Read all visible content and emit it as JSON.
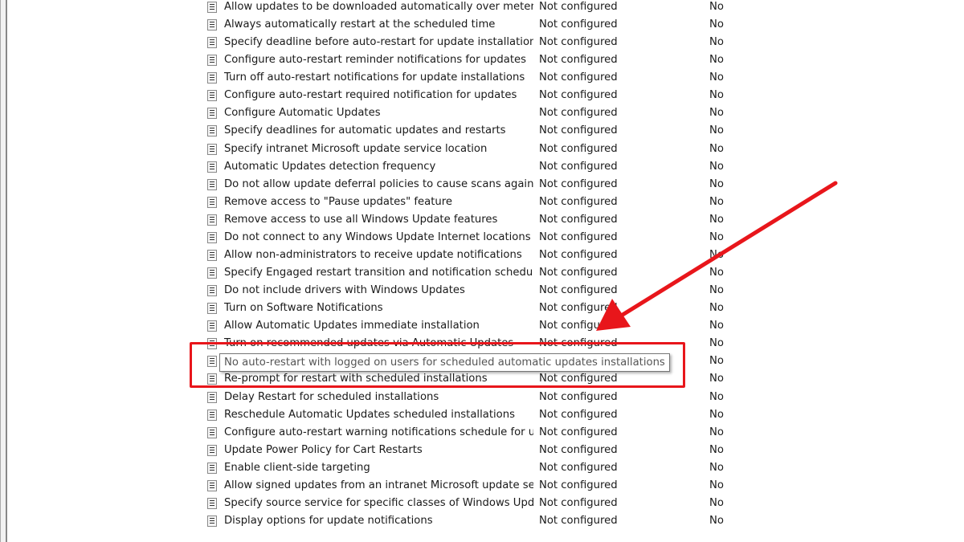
{
  "rows": [
    [
      "Allow updates to be downloaded automatically over metere...",
      "Not configured",
      "No"
    ],
    [
      "Always automatically restart at the scheduled time",
      "Not configured",
      "No"
    ],
    [
      "Specify deadline before auto-restart for update installation",
      "Not configured",
      "No"
    ],
    [
      "Configure auto-restart reminder notifications for updates",
      "Not configured",
      "No"
    ],
    [
      "Turn off auto-restart notifications for update installations",
      "Not configured",
      "No"
    ],
    [
      "Configure auto-restart required notification for updates",
      "Not configured",
      "No"
    ],
    [
      "Configure Automatic Updates",
      "Not configured",
      "No"
    ],
    [
      "Specify deadlines for automatic updates and restarts",
      "Not configured",
      "No"
    ],
    [
      "Specify intranet Microsoft update service location",
      "Not configured",
      "No"
    ],
    [
      "Automatic Updates detection frequency",
      "Not configured",
      "No"
    ],
    [
      "Do not allow update deferral policies to cause scans against ...",
      "Not configured",
      "No"
    ],
    [
      "Remove access to \"Pause updates\" feature",
      "Not configured",
      "No"
    ],
    [
      "Remove access to use all Windows Update features",
      "Not configured",
      "No"
    ],
    [
      "Do not connect to any Windows Update Internet locations",
      "Not configured",
      "No"
    ],
    [
      "Allow non-administrators to receive update notifications",
      "Not configured",
      "No"
    ],
    [
      "Specify Engaged restart transition and notification schedule ...",
      "Not configured",
      "No"
    ],
    [
      "Do not include drivers with Windows Updates",
      "Not configured",
      "No"
    ],
    [
      "Turn on Software Notifications",
      "Not configured",
      "No"
    ],
    [
      "Allow Automatic Updates immediate installation",
      "Not configured",
      "No"
    ],
    [
      "Turn on recommended updates via Automatic Updates",
      "Not configured",
      "No"
    ],
    [
      "",
      "",
      "No"
    ],
    [
      "Re-prompt for restart with scheduled installations",
      "Not configured",
      "No"
    ],
    [
      "Delay Restart for scheduled installations",
      "Not configured",
      "No"
    ],
    [
      "Reschedule Automatic Updates scheduled installations",
      "Not configured",
      "No"
    ],
    [
      "Configure auto-restart warning notifications schedule for u...",
      "Not configured",
      "No"
    ],
    [
      "Update Power Policy for Cart Restarts",
      "Not configured",
      "No"
    ],
    [
      "Enable client-side targeting",
      "Not configured",
      "No"
    ],
    [
      "Allow signed updates from an intranet Microsoft update ser...",
      "Not configured",
      "No"
    ],
    [
      "Specify source service for specific classes of Windows Updat...",
      "Not configured",
      "No"
    ],
    [
      "Display options for update notifications",
      "Not configured",
      "No"
    ]
  ],
  "tooltip": "No auto-restart with logged on users for scheduled automatic updates installations",
  "annotation_color": "#e8161b",
  "icon": "policy-setting-icon"
}
